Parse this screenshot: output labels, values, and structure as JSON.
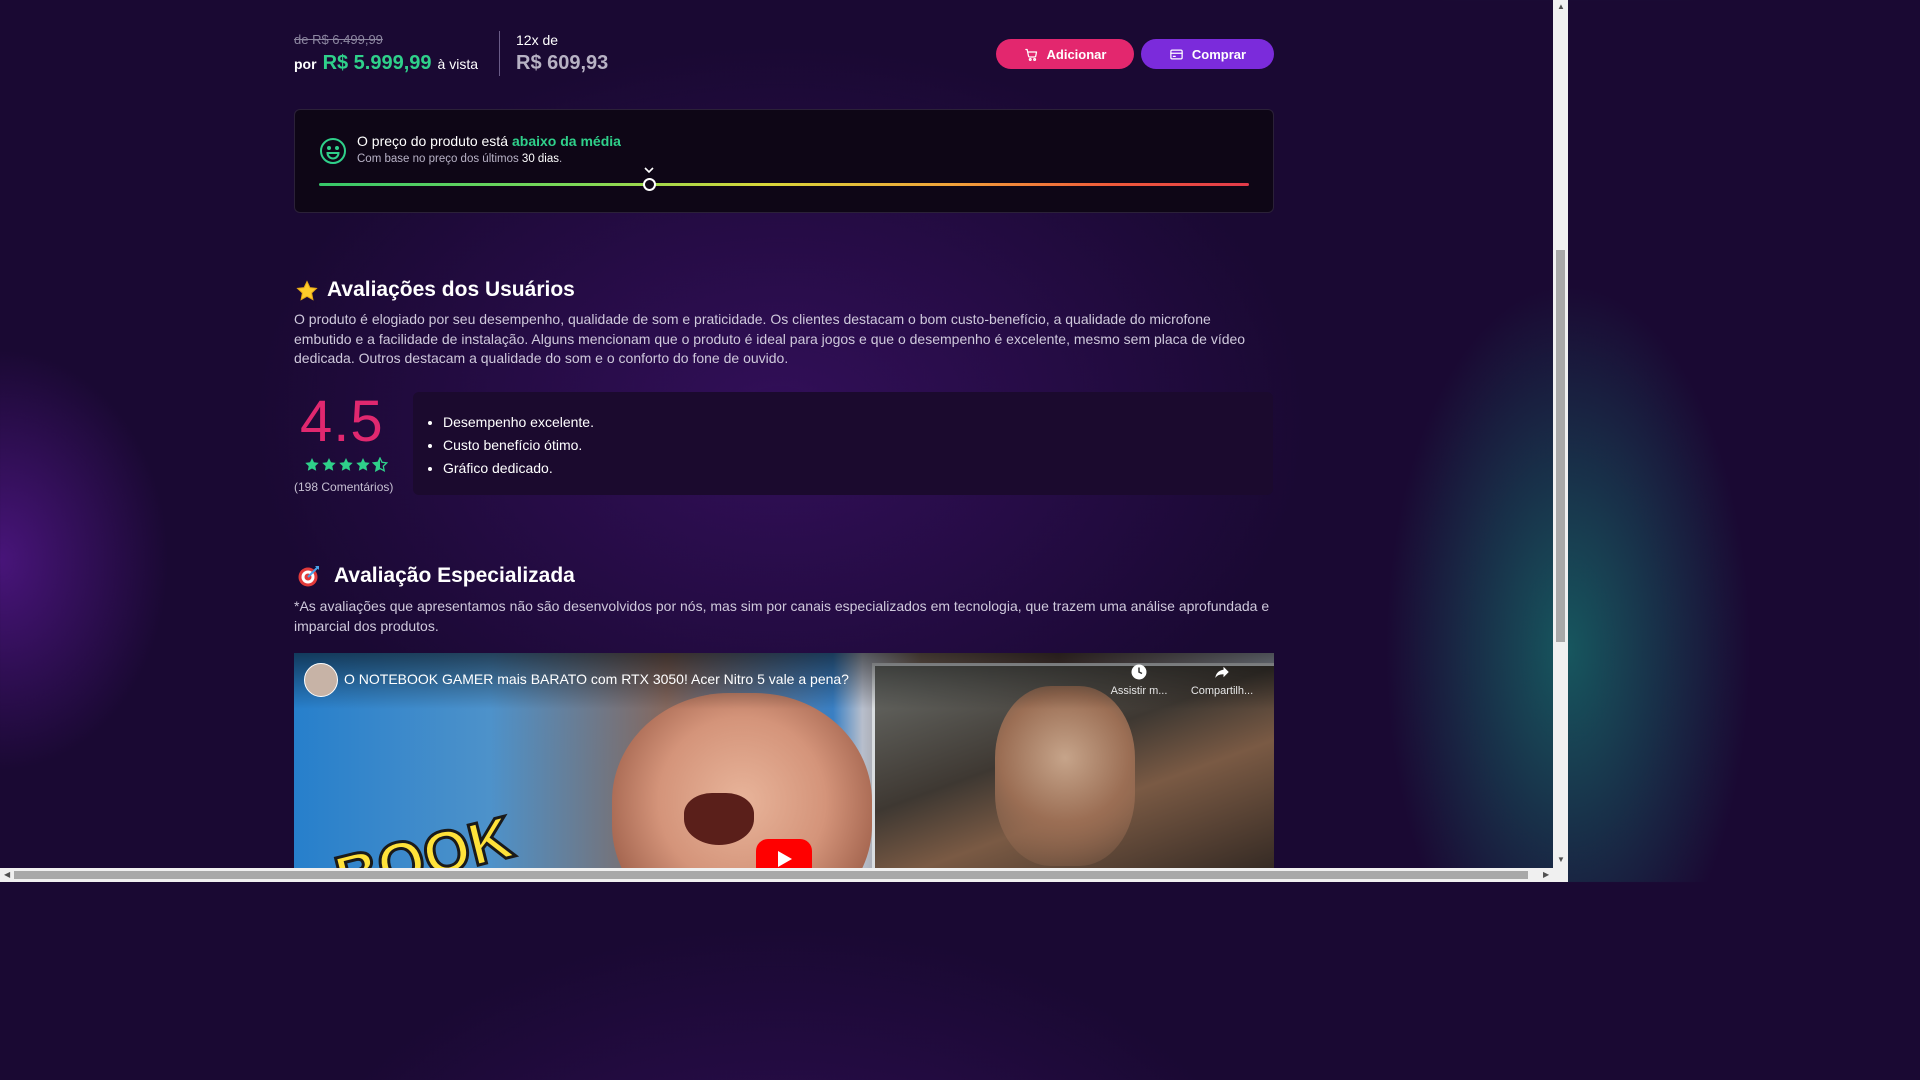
{
  "pricing": {
    "old_price": "de R$ 6.499,99",
    "por_label": "por",
    "current_price": "R$ 5.999,99",
    "cash_label": "à vista",
    "installments_label": "12x de",
    "installment_value": "R$ 609,93"
  },
  "actions": {
    "add_label": "Adicionar",
    "buy_label": "Comprar"
  },
  "price_meter": {
    "text": "O preço do produto está",
    "highlight": "abaixo da média",
    "sub_prefix": "Com base no preço dos últimos",
    "sub_days": "30 dias",
    "sub_suffix": ".",
    "position_fraction": 0.355,
    "highlight_color": "#2fd08a"
  },
  "user_reviews": {
    "title": "Avaliações dos Usuários",
    "icon": "star-icon",
    "summary": "O produto é elogiado por seu desempenho, qualidade de som e praticidade. Os clientes destacam o bom custo-benefício, a qualidade do microfone embutido e a facilidade de instalação. Alguns mencionam que o produto é ideal para jogos e que o desempenho é excelente, mesmo sem placa de vídeo dedicada. Outros destacam a qualidade do som e o conforto do fone de ouvido.",
    "rating": "4.5",
    "rating_value": 4.5,
    "rating_max": 5,
    "count_label": "(198 Comentários)",
    "pros": [
      "Desempenho excelente.",
      "Custo benefício ótimo.",
      "Gráfico dedicado."
    ],
    "accent_color": "#e0286f",
    "star_color": "#2fd08a"
  },
  "expert_review": {
    "title": "Avaliação Especializada",
    "icon": "target-icon",
    "disclaimer": "*As avaliações que apresentamos não são desenvolvidos por nós, mas sim por canais especializados em tecnologia, que trazem uma análise aprofundada e imparcial dos produtos."
  },
  "video": {
    "title": "O NOTEBOOK GAMER mais BARATO com RTX 3050! Acer Nitro 5 vale a pena?",
    "watch_later": "Assistir m...",
    "share": "Compartilh..."
  }
}
